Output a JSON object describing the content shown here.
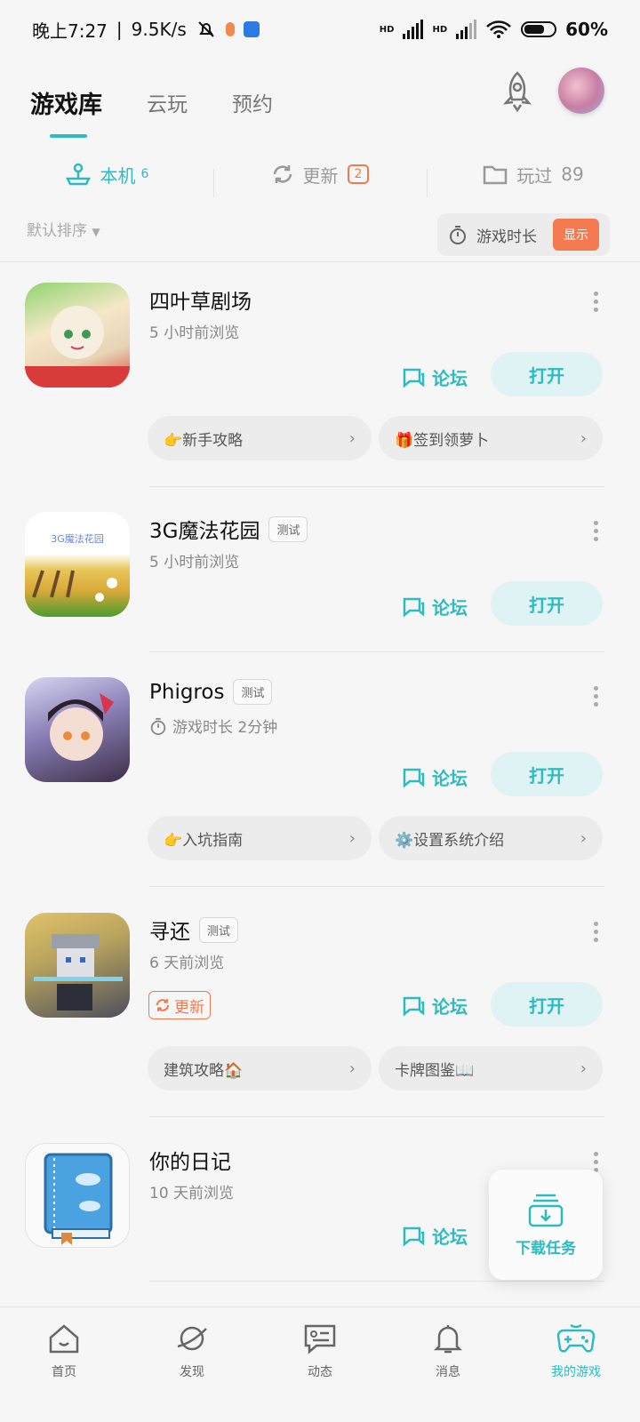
{
  "status_bar": {
    "time": "晚上7:27",
    "speed": "9.5K/s",
    "battery": "60%",
    "hd1": "HD",
    "hd2": "HD"
  },
  "top_tabs": [
    {
      "label": "游戏库",
      "active": true
    },
    {
      "label": "云玩",
      "active": false
    },
    {
      "label": "预约",
      "active": false
    }
  ],
  "sub_tabs": {
    "local": {
      "label": "本机",
      "count": "6"
    },
    "update": {
      "label": "更新",
      "count": "2"
    },
    "played": {
      "label": "玩过",
      "count": "89"
    }
  },
  "sort": {
    "label": "默认排序"
  },
  "playtime_toggle": {
    "label": "游戏时长",
    "button": "显示"
  },
  "actions": {
    "forum": "论坛",
    "open": "打开",
    "update": "更新"
  },
  "games": [
    {
      "title": "四叶草剧场",
      "subtitle": "5 小时前浏览",
      "tag": "",
      "guides": [
        "👉新手攻略",
        "🎁签到领萝卜"
      ]
    },
    {
      "title": "3G魔法花园",
      "subtitle": "5 小时前浏览",
      "tag": "测试",
      "icon_text": "3G魔法花园"
    },
    {
      "title": "Phigros",
      "subtitle": "游戏时长 2分钟",
      "tag": "测试",
      "guides": [
        "👉入坑指南",
        "⚙️设置系统介绍"
      ]
    },
    {
      "title": "寻还",
      "subtitle": "6 天前浏览",
      "tag": "测试",
      "guides": [
        "建筑攻略🏠",
        "卡牌图鉴📖"
      ]
    },
    {
      "title": "你的日记",
      "subtitle": "10 天前浏览",
      "tag": ""
    }
  ],
  "download_fab": {
    "label": "下载任务"
  },
  "bottom_nav": [
    {
      "label": "首页",
      "icon": "home-icon"
    },
    {
      "label": "发现",
      "icon": "planet-icon"
    },
    {
      "label": "动态",
      "icon": "chat-icon"
    },
    {
      "label": "消息",
      "icon": "bell-icon"
    },
    {
      "label": "我的游戏",
      "icon": "gamepad-icon",
      "active": true
    }
  ],
  "colors": {
    "accent": "#2dbbc0",
    "orange": "#f07a4f"
  }
}
